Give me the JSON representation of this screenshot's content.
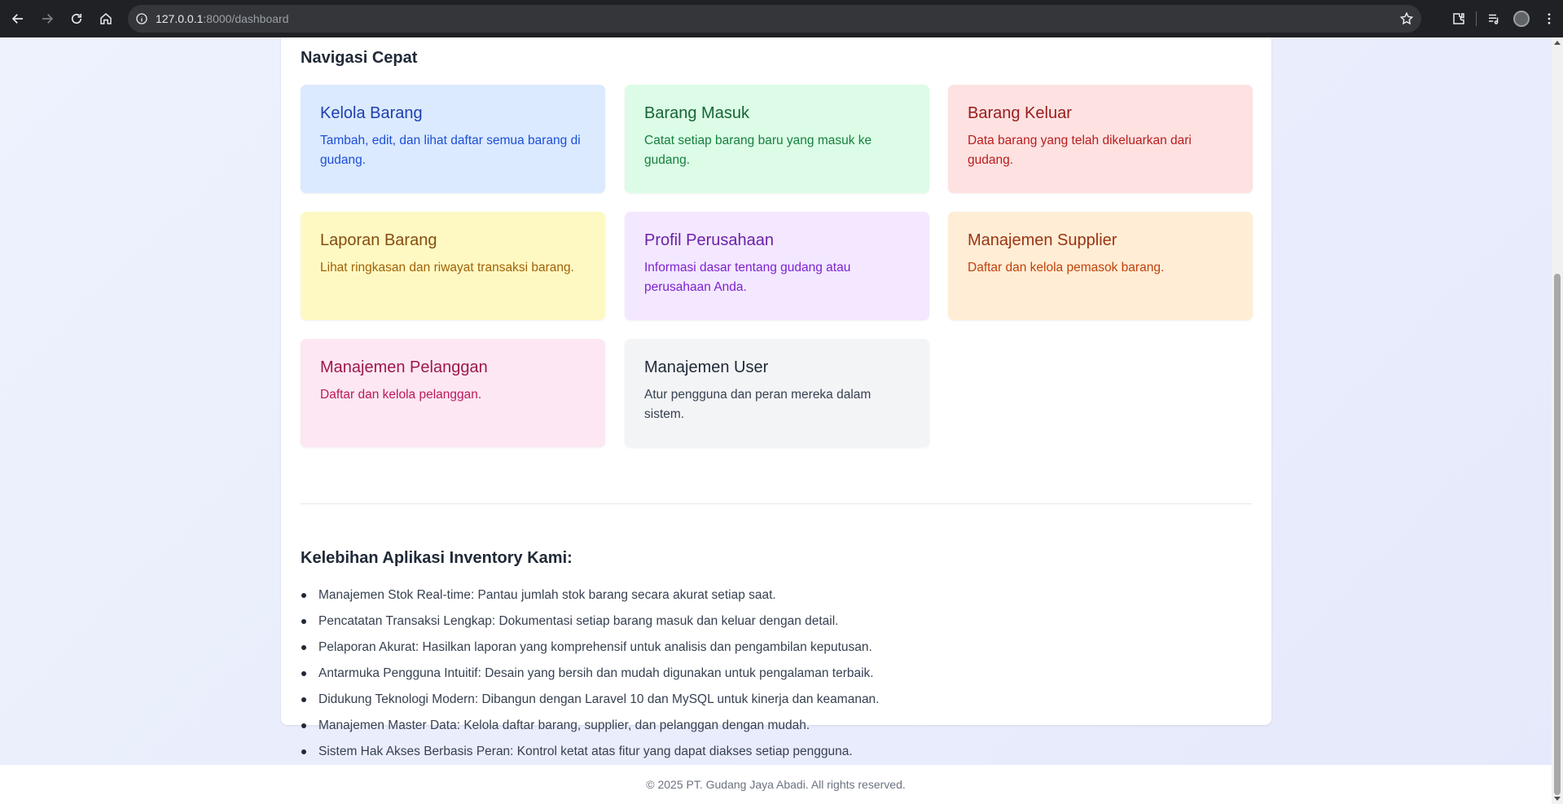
{
  "browser": {
    "url_host": "127.0.0.1",
    "url_rest": ":8000/dashboard"
  },
  "nav_section": {
    "title": "Navigasi Cepat",
    "cards": [
      {
        "title": "Kelola Barang",
        "desc": "Tambah, edit, dan lihat daftar semua barang di gudang.",
        "bg": "#dbeafe",
        "title_color": "#1e40af",
        "desc_color": "#1d4ed8"
      },
      {
        "title": "Barang Masuk",
        "desc": "Catat setiap barang baru yang masuk ke gudang.",
        "bg": "#dcfce7",
        "title_color": "#166534",
        "desc_color": "#15803d"
      },
      {
        "title": "Barang Keluar",
        "desc": "Data barang yang telah dikeluarkan dari gudang.",
        "bg": "#fee2e2",
        "title_color": "#991b1b",
        "desc_color": "#b91c1c"
      },
      {
        "title": "Laporan Barang",
        "desc": "Lihat ringkasan dan riwayat transaksi barang.",
        "bg": "#fef9c3",
        "title_color": "#854d0e",
        "desc_color": "#a16207"
      },
      {
        "title": "Profil Perusahaan",
        "desc": "Informasi dasar tentang gudang atau perusahaan Anda.",
        "bg": "#f3e8ff",
        "title_color": "#6b21a8",
        "desc_color": "#7e22ce"
      },
      {
        "title": "Manajemen Supplier",
        "desc": "Daftar dan kelola pemasok barang.",
        "bg": "#ffedd5",
        "title_color": "#9a3412",
        "desc_color": "#c2410c"
      },
      {
        "title": "Manajemen Pelanggan",
        "desc": "Daftar dan kelola pelanggan.",
        "bg": "#fce7f3",
        "title_color": "#9d174d",
        "desc_color": "#be185d"
      },
      {
        "title": "Manajemen User",
        "desc": "Atur pengguna dan peran mereka dalam sistem.",
        "bg": "#f3f4f6",
        "title_color": "#1f2937",
        "desc_color": "#374151"
      }
    ]
  },
  "advantages": {
    "title": "Kelebihan Aplikasi Inventory Kami:",
    "items": [
      "Manajemen Stok Real-time: Pantau jumlah stok barang secara akurat setiap saat.",
      "Pencatatan Transaksi Lengkap: Dokumentasi setiap barang masuk dan keluar dengan detail.",
      "Pelaporan Akurat: Hasilkan laporan yang komprehensif untuk analisis dan pengambilan keputusan.",
      "Antarmuka Pengguna Intuitif: Desain yang bersih dan mudah digunakan untuk pengalaman terbaik.",
      "Didukung Teknologi Modern: Dibangun dengan Laravel 10 dan MySQL untuk kinerja dan keamanan.",
      "Manajemen Master Data: Kelola daftar barang, supplier, dan pelanggan dengan mudah.",
      "Sistem Hak Akses Berbasis Peran: Kontrol ketat atas fitur yang dapat diakses setiap pengguna."
    ]
  },
  "footer": {
    "text": "© 2025 PT. Gudang Jaya Abadi. All rights reserved."
  }
}
